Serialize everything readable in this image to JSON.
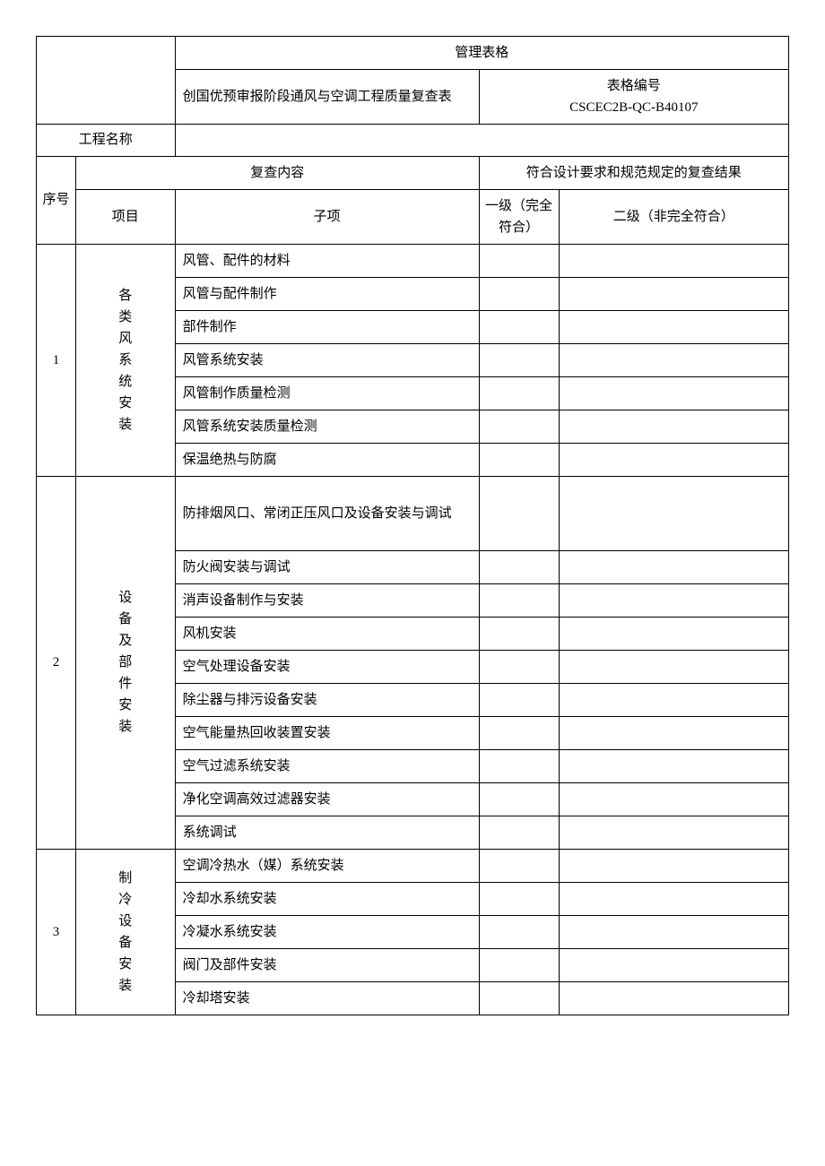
{
  "header": {
    "management_form": "管理表格",
    "form_title": "创国优预审报阶段通风与空调工程质量复查表",
    "form_code_label": "表格编号",
    "form_code": "CSCEC2B-QC-B40107",
    "project_name_label": "工程名称",
    "project_name_value": ""
  },
  "column_headers": {
    "seq": "序号",
    "review_content": "复查内容",
    "result": "符合设计要求和规范规定的复查结果",
    "project": "项目",
    "subitem": "子项",
    "level1": "一级（完全符合）",
    "level2": "二级（非完全符合）"
  },
  "sections": [
    {
      "seq": "1",
      "project": "各类风系统安装",
      "subitems": [
        "风管、配件的材料",
        "风管与配件制作",
        "部件制作",
        "风管系统安装",
        "风管制作质量检测",
        "风管系统安装质量检测",
        "保温绝热与防腐"
      ]
    },
    {
      "seq": "2",
      "project": "设备及部件安装",
      "subitems": [
        "防排烟风口、常闭正压风口及设备安装与调试",
        "防火阀安装与调试",
        "消声设备制作与安装",
        "风机安装",
        "空气处理设备安装",
        "除尘器与排污设备安装",
        "空气能量热回收装置安装",
        "空气过滤系统安装",
        "净化空调高效过滤器安装",
        "系统调试"
      ]
    },
    {
      "seq": "3",
      "project": "制冷设备安装",
      "subitems": [
        "空调冷热水（媒）系统安装",
        "冷却水系统安装",
        "冷凝水系统安装",
        "阀门及部件安装",
        "冷却塔安装"
      ]
    }
  ]
}
